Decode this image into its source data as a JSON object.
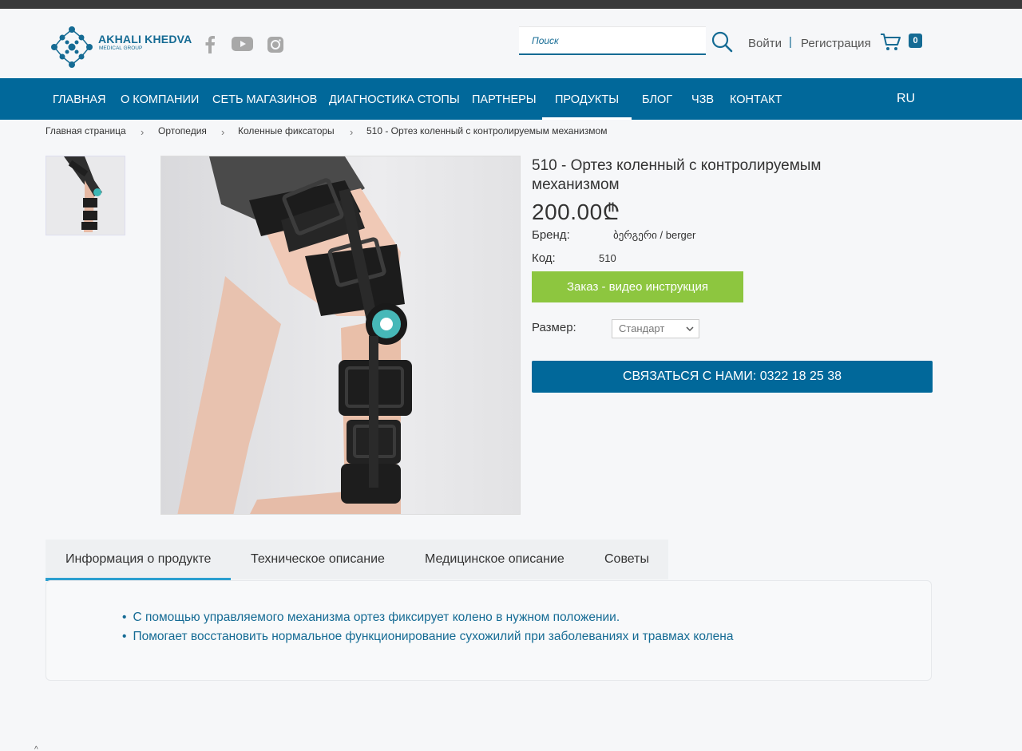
{
  "header": {
    "logo_title": "AKHALI KHEDVA",
    "logo_subtitle": "MEDICAL GROUP",
    "search_placeholder": "Поиск",
    "login": "Войти",
    "separator": "|",
    "register": "Регистрация",
    "cart_count": "0",
    "social": [
      "facebook-icon",
      "youtube-icon",
      "instagram-icon"
    ]
  },
  "nav": {
    "items": [
      "ГЛАВНАЯ",
      "О КОМПАНИИ",
      "СЕТЬ МАГАЗИНОВ",
      "ДИАГНОСТИКА СТОПЫ",
      "ПАРТНЕРЫ",
      "ПРОДУКТЫ",
      "БЛОГ",
      "ЧЗВ",
      "КОНТАКТ"
    ],
    "active": "ПРОДУКТЫ",
    "lang": "RU"
  },
  "breadcrumb": [
    "Главная страница",
    "Ортопедия",
    "Коленные фиксаторы",
    "510 - Ортез коленный с контролируемым механизмом"
  ],
  "product": {
    "title": "510 - Ортез коленный с контролируемым механизмом",
    "price": "200.00₾",
    "brand_label": "Бренд:",
    "brand_value": "ბერგერი / berger",
    "code_label": "Код:",
    "code_value": "510",
    "order_button": "Заказ - видео инструкция",
    "size_label": "Размер:",
    "size_value": "Стандарт",
    "contact_button": "СВЯЗАТЬСЯ С НАМИ: 0322 18 25 38"
  },
  "tabs": {
    "items": [
      "Информация о продукте",
      "Техническое описание",
      "Медицинское описание",
      "Советы"
    ],
    "active": "Информация о продукте"
  },
  "info": {
    "bullets": [
      "С помощью управляемого механизма ортез фиксирует колено в нужном положении.",
      "Помогает восстановить нормальное функционирование сухожилий при заболеваниях и травмах колена"
    ]
  },
  "colors": {
    "brand_blue": "#01689a",
    "order_green": "#8dc63f",
    "link_blue": "#156b94",
    "tab_underline": "#2b9fd0"
  },
  "footer_mark": "^"
}
